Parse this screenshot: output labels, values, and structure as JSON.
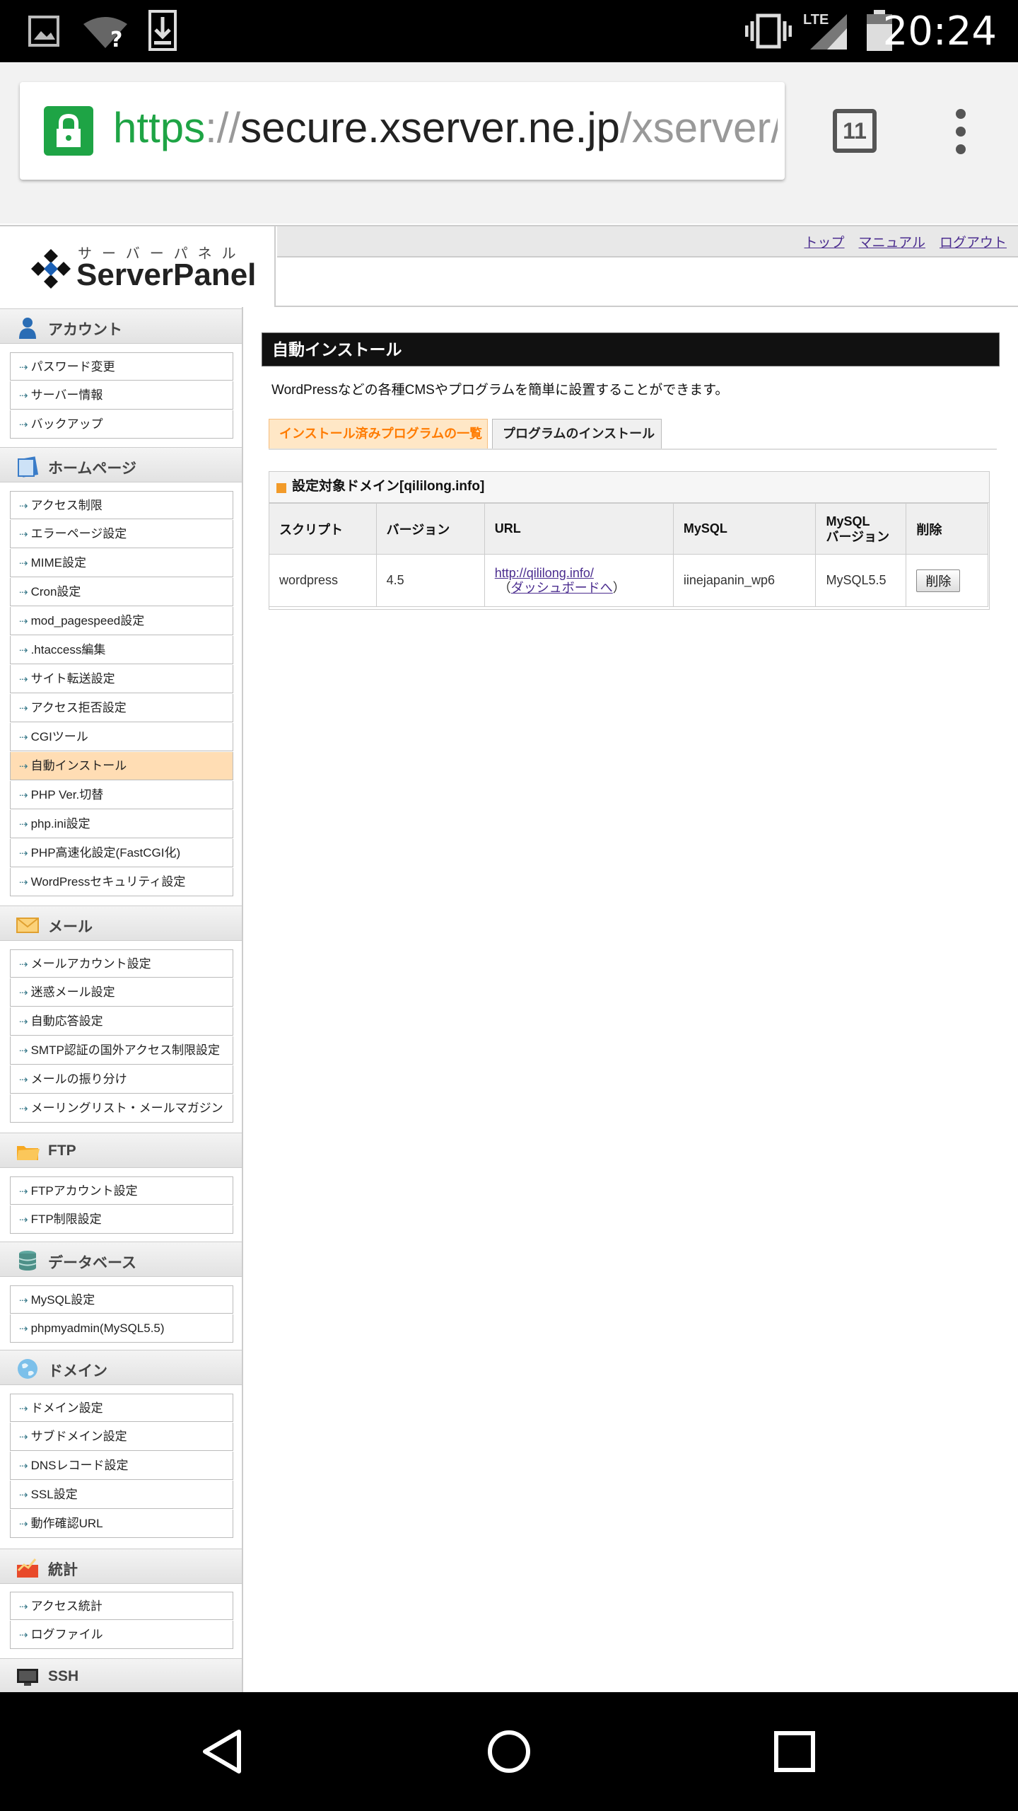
{
  "status_bar": {
    "time": "20:24",
    "network": "LTE"
  },
  "browser": {
    "url_scheme": "https",
    "url_sep": "://",
    "url_host": "secure.xserver.ne.jp",
    "url_path": "/xserver/",
    "tab_count": "11"
  },
  "header": {
    "logo_kana": "サーバーパネル",
    "logo_name": "ServerPanel",
    "links": [
      "トップ",
      "マニュアル",
      "ログアウト"
    ]
  },
  "sidebar": {
    "sections": [
      {
        "title": "アカウント",
        "items": [
          "パスワード変更",
          "サーバー情報",
          "バックアップ"
        ]
      },
      {
        "title": "ホームページ",
        "items": [
          "アクセス制限",
          "エラーページ設定",
          "MIME設定",
          "Cron設定",
          "mod_pagespeed設定",
          ".htaccess編集",
          "サイト転送設定",
          "アクセス拒否設定",
          "CGIツール",
          "自動インストール",
          "PHP Ver.切替",
          "php.ini設定",
          "PHP高速化設定(FastCGI化)",
          "WordPressセキュリティ設定"
        ]
      },
      {
        "title": "メール",
        "items": [
          "メールアカウント設定",
          "迷惑メール設定",
          "自動応答設定",
          "SMTP認証の国外アクセス制限設定",
          "メールの振り分け",
          "メーリングリスト・メールマガジン"
        ]
      },
      {
        "title": "FTP",
        "items": [
          "FTPアカウント設定",
          "FTP制限設定"
        ]
      },
      {
        "title": "データベース",
        "items": [
          "MySQL設定",
          "phpmyadmin(MySQL5.5)"
        ]
      },
      {
        "title": "ドメイン",
        "items": [
          "ドメイン設定",
          "サブドメイン設定",
          "DNSレコード設定",
          "SSL設定",
          "動作確認URL"
        ]
      },
      {
        "title": "統計",
        "items": [
          "アクセス統計",
          "ログファイル"
        ]
      },
      {
        "title": "SSH",
        "items": []
      }
    ],
    "active_item": "自動インストール"
  },
  "main": {
    "title": "自動インストール",
    "description": "WordPressなどの各種CMSやプログラムを簡単に設置することができます。",
    "tabs": [
      "インストール済みプログラムの一覧",
      "プログラムのインストール"
    ],
    "domain_heading": "設定対象ドメイン[qililong.info]",
    "table": {
      "headers": [
        "スクリプト",
        "バージョン",
        "URL",
        "MySQL",
        "MySQL",
        "バージョン",
        "削除"
      ],
      "row": {
        "script": "wordpress",
        "version": "4.5",
        "url": "http://qililong.info/",
        "dashboard_open": "（",
        "dashboard": "ダッシュボードへ",
        "dashboard_close": "）",
        "mysql": "iinejapanin_wp6",
        "mysql_version": "MySQL5.5",
        "delete_label": "削除"
      }
    }
  },
  "colors": {
    "accent_orange": "#ff7b00",
    "active_row": "#ffddb4",
    "link": "#4b2d8f",
    "lock_green": "#1ea445"
  }
}
